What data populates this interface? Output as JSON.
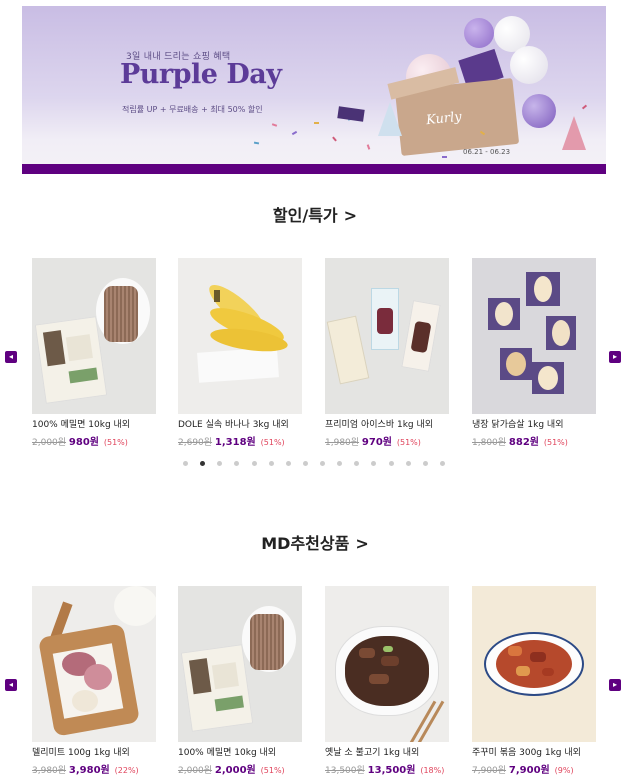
{
  "banner": {
    "subtitle": "3일 내내 드리는 쇼핑 혜택",
    "title": "Purple Day",
    "tagline": "적립률 UP + 무료배송 + 최대 50% 할인",
    "date": "06.21 - 06.23",
    "box_text": "Kurly",
    "colors": {
      "accent": "#5f0080",
      "title": "#5c3b98"
    }
  },
  "sections": [
    {
      "title": "할인/특가",
      "arrow": ">",
      "products": [
        {
          "name": "100% 메밀면 10kg 내외",
          "original": "2,000원",
          "sale": "980원",
          "rate": "(51%)"
        },
        {
          "name": "DOLE 실속 바나나 3kg 내외",
          "original": "2,690원",
          "sale": "1,318원",
          "rate": "(51%)"
        },
        {
          "name": "프리미엄 아이스바 1kg 내외",
          "original": "1,980원",
          "sale": "970원",
          "rate": "(51%)"
        },
        {
          "name": "냉장 닭가슴살 1kg 내외",
          "original": "1,800원",
          "sale": "882원",
          "rate": "(51%)"
        }
      ],
      "pager": {
        "count": 16,
        "active_index": 1
      }
    },
    {
      "title": "MD추천상품",
      "arrow": ">",
      "products": [
        {
          "name": "델리미트 100g 1kg 내외",
          "original": "3,980원",
          "sale": "3,980원",
          "rate": "(22%)"
        },
        {
          "name": "100% 메밀면 10kg 내외",
          "original": "2,000원",
          "sale": "2,000원",
          "rate": "(51%)"
        },
        {
          "name": "옛날 소 불고기 1kg 내외",
          "original": "13,500원",
          "sale": "13,500원",
          "rate": "(18%)"
        },
        {
          "name": "주꾸미 볶음 300g 1kg 내외",
          "original": "7,900원",
          "sale": "7,900원",
          "rate": "(9%)"
        }
      ]
    }
  ],
  "nav": {
    "prev_icon": "chevron-left-icon",
    "next_icon": "chevron-right-icon",
    "prev_glyph": "◂",
    "next_glyph": "▸"
  }
}
